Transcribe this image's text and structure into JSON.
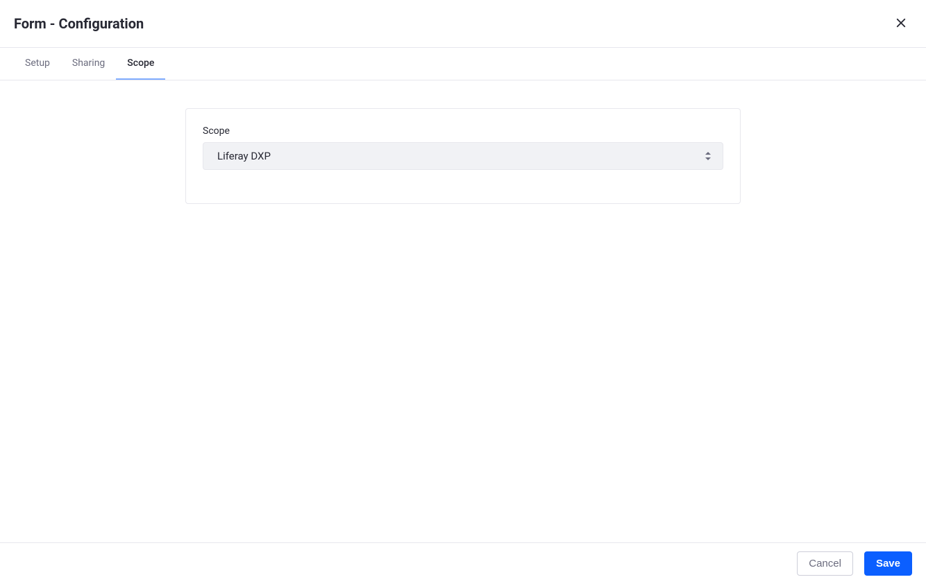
{
  "header": {
    "title": "Form - Configuration"
  },
  "tabs": [
    {
      "label": "Setup",
      "active": false
    },
    {
      "label": "Sharing",
      "active": false
    },
    {
      "label": "Scope",
      "active": true
    }
  ],
  "main": {
    "scope_label": "Scope",
    "scope_value": "Liferay DXP"
  },
  "footer": {
    "cancel_label": "Cancel",
    "save_label": "Save"
  }
}
